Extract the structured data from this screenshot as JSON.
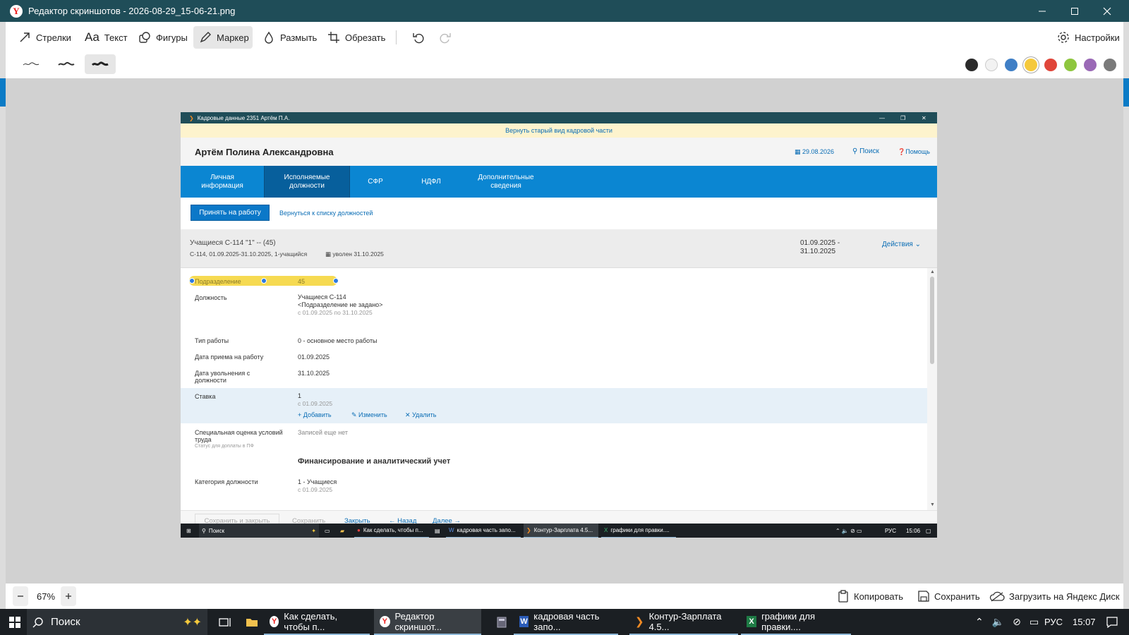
{
  "editor": {
    "title": "Редактор скриншотов - 2026-08-29_15-06-21.png",
    "tools": {
      "arrows": "Стрелки",
      "text": "Текст",
      "shapes": "Фигуры",
      "marker": "Маркер",
      "blur": "Размыть",
      "crop": "Обрезать"
    },
    "settings": "Настройки",
    "colors": [
      "#2b2b2b",
      "#f2f2f2",
      "#3f7fc6",
      "#f5c93c",
      "#e0463a",
      "#8ec63f",
      "#9a69b6",
      "#7a7a7a"
    ],
    "zoom": "67%",
    "copy": "Копировать",
    "save": "Сохранить",
    "upload": "Загрузить на Яндекс Диск"
  },
  "taskbar": {
    "search": "Поиск",
    "apps": [
      "Как сделать, чтобы п...",
      "Редактор скриншот...",
      "кадровая часть запо...",
      "Контур-Зарплата 4.5...",
      "графики для правки...."
    ],
    "lang": "РУС",
    "time": "15:07"
  },
  "shot": {
    "window_title": "Кадровые данные  2351  Артём П.А.",
    "banner": "Вернуть старый вид кадровой части",
    "person": "Артём Полина Александровна",
    "date": "29.08.2026",
    "search": "Поиск",
    "help": "Помощь",
    "tabs": [
      "Личная информация",
      "Исполняемые должности",
      "СФР",
      "НДФЛ",
      "Дополнительные сведения"
    ],
    "hire_button": "Принять на работу",
    "back_link": "Вернуться к списку должностей",
    "record": {
      "title": "Учащиеся С-114 \"1\" --  (45)",
      "details": "С-114, 01.09.2025-31.10.2025, 1-учащийся",
      "dismissed": "уволен 31.10.2025",
      "period_start": "01.09.2025 -",
      "period_end": "31.10.2025",
      "actions": "Действия"
    },
    "form": {
      "department_label": "Подразделение",
      "department_value": "45",
      "position_label": "Должность",
      "position_value": "Учащиеся С-114",
      "position_dept": "<Подразделение не задано>",
      "position_period": "с 01.09.2025 по 31.10.2025",
      "work_type_label": "Тип работы",
      "work_type_value": "0 - основное место работы",
      "hire_date_label": "Дата приема на работу",
      "hire_date_value": "01.09.2025",
      "dismiss_date_label": "Дата увольнения с должности",
      "dismiss_date_value": "31.10.2025",
      "rate_label": "Ставка",
      "rate_value": "1",
      "rate_since": "с 01.09.2025",
      "add": "Добавить",
      "edit": "Изменить",
      "delete": "Удалить",
      "sout_label": "Специальная оценка условий труда",
      "sout_sub": "Статус для доплаты в ПФ",
      "sout_value": "Записей еще нет",
      "section_title": "Финансирование и аналитический учет",
      "category_label": "Категория должности",
      "category_value": "1 - Учащиеся",
      "category_since": "с 01.09.2025"
    },
    "footer": {
      "save_close": "Сохранить и закрыть",
      "save": "Сохранить",
      "close": "Закрыть",
      "back": "Назад",
      "next": "Далее"
    },
    "taskbar": {
      "search": "Поиск",
      "apps": [
        "Как сделать, чтобы п...",
        "кадровая часть запо...",
        "Контур-Зарплата 4.5...",
        "графики для правки...."
      ],
      "lang": "РУС",
      "time": "15:06"
    }
  }
}
